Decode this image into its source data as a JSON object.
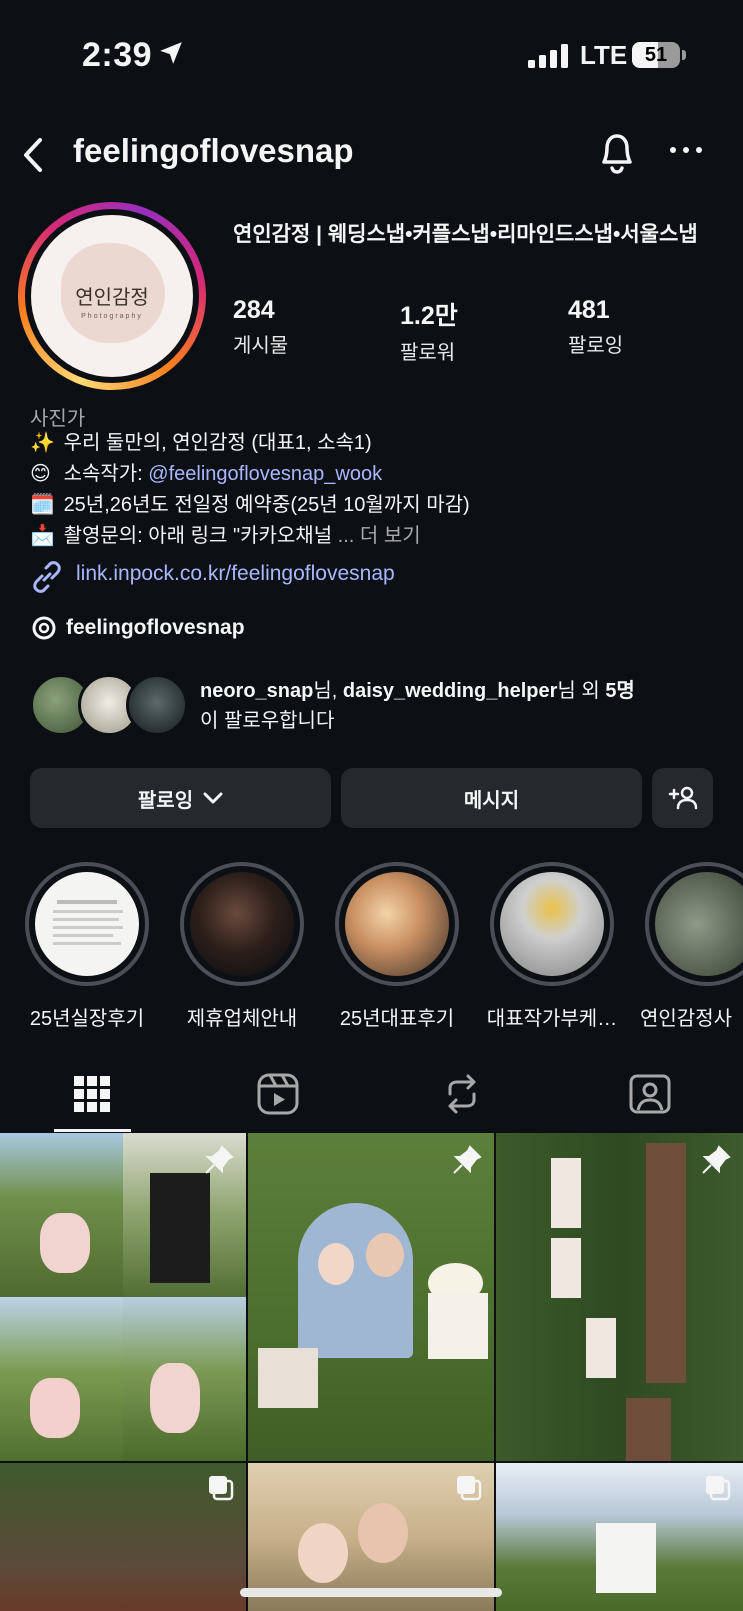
{
  "status_bar": {
    "time": "2:39",
    "network": "LTE",
    "battery": "51"
  },
  "nav": {
    "username": "feelingoflovesnap"
  },
  "profile": {
    "avatar_text": "연인감정",
    "avatar_subtext": "Photography",
    "display_name": "연인감정 | 웨딩스냅•커플스냅•리마인드스냅•서울스냅",
    "stats": [
      {
        "value": "284",
        "label": "게시물"
      },
      {
        "value": "1.2만",
        "label": "팔로워"
      },
      {
        "value": "481",
        "label": "팔로잉"
      }
    ],
    "category": "사진가",
    "bio": {
      "line1_emoji": "✨",
      "line1": "우리 둘만의, 연인감정 (대표1, 소속1)",
      "line2_emoji": "😊",
      "line2_prefix": "소속작가: ",
      "line2_mention": "@feelingoflovesnap_wook",
      "line3_emoji": "🗓️",
      "line3": "25년,26년도 전일정 예약중(25년 10월까지 마감)",
      "line4_emoji": "📩",
      "line4": "촬영문의: 아래 링크 \"카카오채널 ",
      "more": "... 더 보기"
    },
    "link": "link.inpock.co.kr/feelingoflovesnap",
    "threads": "feelingoflovesnap",
    "mutual": {
      "user1": "neoro_snap",
      "sep1": "님, ",
      "user2": "daisy_wedding_helper",
      "sep2": "님 외 ",
      "count": "5명",
      "suffix": "이 팔로우합니다"
    }
  },
  "actions": {
    "following": "팔로잉",
    "message": "메시지"
  },
  "highlights": [
    {
      "label": "25년실장후기"
    },
    {
      "label": "제휴업체안내"
    },
    {
      "label": "25년대표후기"
    },
    {
      "label": "대표작가부케…"
    },
    {
      "label": "연인감정사"
    }
  ],
  "tabs": [
    "posts",
    "reels",
    "reposts",
    "tagged"
  ],
  "colors": {
    "background": "#0c1014",
    "button": "#25292e",
    "link": "#a9b7ff",
    "muted": "#a8a8a8"
  }
}
